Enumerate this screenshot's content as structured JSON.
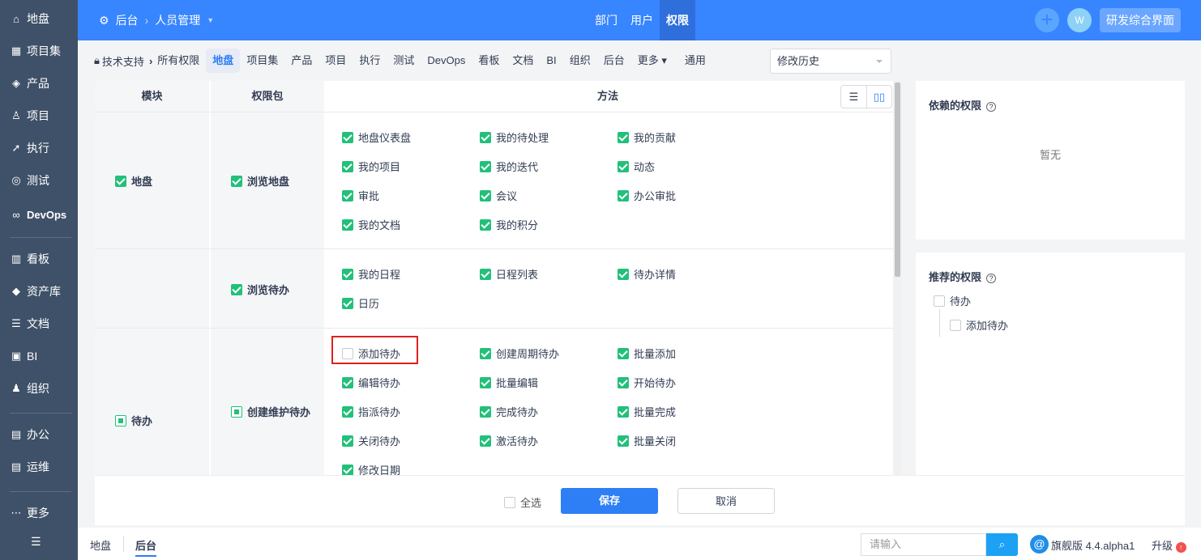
{
  "sidebar": {
    "items": [
      {
        "icon": "home-icon",
        "glyph": "⌂",
        "label": "地盘"
      },
      {
        "icon": "grid-icon",
        "glyph": "▦",
        "label": "项目集"
      },
      {
        "icon": "product-icon",
        "glyph": "◈",
        "label": "产品"
      },
      {
        "icon": "project-icon",
        "glyph": "♙",
        "label": "项目"
      },
      {
        "icon": "run-icon",
        "glyph": "➚",
        "label": "执行"
      },
      {
        "icon": "test-icon",
        "glyph": "◎",
        "label": "测试"
      },
      {
        "icon": "infinity-icon",
        "glyph": "∞",
        "label": "DevOps"
      },
      {
        "icon": "kanban-icon",
        "glyph": "▥",
        "label": "看板"
      },
      {
        "icon": "diamond-icon",
        "glyph": "◆",
        "label": "资产库"
      },
      {
        "icon": "doc-icon",
        "glyph": "☰",
        "label": "文档"
      },
      {
        "icon": "chart-icon",
        "glyph": "▣",
        "label": "BI"
      },
      {
        "icon": "people-icon",
        "glyph": "♟",
        "label": "组织"
      },
      {
        "icon": "oa-icon",
        "glyph": "▤",
        "label": "办公"
      },
      {
        "icon": "ops-icon",
        "glyph": "▤",
        "label": "运维"
      },
      {
        "icon": "more-icon",
        "glyph": "⋯",
        "label": "更多"
      }
    ],
    "menu_glyph": "☰"
  },
  "topbar": {
    "crumb_root": "后台",
    "crumb_current": "人员管理",
    "tabs": [
      "部门",
      "用户",
      "权限"
    ],
    "active_tab": "权限",
    "avatar": "W",
    "switch_label": "研发综合界面"
  },
  "subnav": {
    "group": "技术支持",
    "all": "所有权限",
    "items": [
      "地盘",
      "项目集",
      "产品",
      "项目",
      "执行",
      "测试",
      "DevOps",
      "看板",
      "文档",
      "BI",
      "组织",
      "后台",
      "更多",
      "通用"
    ],
    "active": "地盘",
    "history": "修改历史"
  },
  "table": {
    "headers": {
      "module": "模块",
      "package": "权限包",
      "method": "方法"
    },
    "rows": [
      {
        "module": "地盘",
        "module_state": "checked",
        "packages": [
          {
            "name": "浏览地盘",
            "state": "checked",
            "methods": [
              [
                "地盘仪表盘",
                1
              ],
              [
                "我的待处理",
                1
              ],
              [
                "我的贡献",
                1
              ],
              [
                "我的项目",
                1
              ],
              [
                "我的迭代",
                1
              ],
              [
                "动态",
                1
              ],
              [
                "审批",
                1
              ],
              [
                "会议",
                1
              ],
              [
                "办公审批",
                1
              ],
              [
                "我的文档",
                1
              ],
              [
                "我的积分",
                1
              ]
            ]
          }
        ]
      },
      {
        "module": "待办",
        "module_state": "partial",
        "packages": [
          {
            "name": "浏览待办",
            "state": "checked",
            "methods": [
              [
                "我的日程",
                1
              ],
              [
                "日程列表",
                1
              ],
              [
                "待办详情",
                1
              ],
              [
                "日历",
                1
              ]
            ]
          },
          {
            "name": "创建维护待办",
            "state": "partial",
            "methods": [
              [
                "添加待办",
                0
              ],
              [
                "创建周期待办",
                1
              ],
              [
                "批量添加",
                1
              ],
              [
                "编辑待办",
                1
              ],
              [
                "批量编辑",
                1
              ],
              [
                "开始待办",
                1
              ],
              [
                "指派待办",
                1
              ],
              [
                "完成待办",
                1
              ],
              [
                "批量完成",
                1
              ],
              [
                "关闭待办",
                1
              ],
              [
                "激活待办",
                1
              ],
              [
                "批量关闭",
                1
              ],
              [
                "修改日期",
                1
              ]
            ]
          }
        ]
      }
    ]
  },
  "depends": {
    "title": "依赖的权限",
    "empty": "暂无"
  },
  "recommend": {
    "title": "推荐的权限",
    "parent": "待办",
    "child": "添加待办"
  },
  "footer": {
    "select_all": "全选",
    "save": "保存",
    "cancel": "取消"
  },
  "bottom": {
    "tabs": [
      "地盘",
      "后台"
    ],
    "active": "后台",
    "search_placeholder": "请输入",
    "version": "旗舰版 4.4.alpha1",
    "upgrade": "升级"
  },
  "colors": {
    "primary": "#3785ff",
    "sidebar": "#3f5168",
    "check": "#22c07a",
    "highlight": "#e02020"
  }
}
